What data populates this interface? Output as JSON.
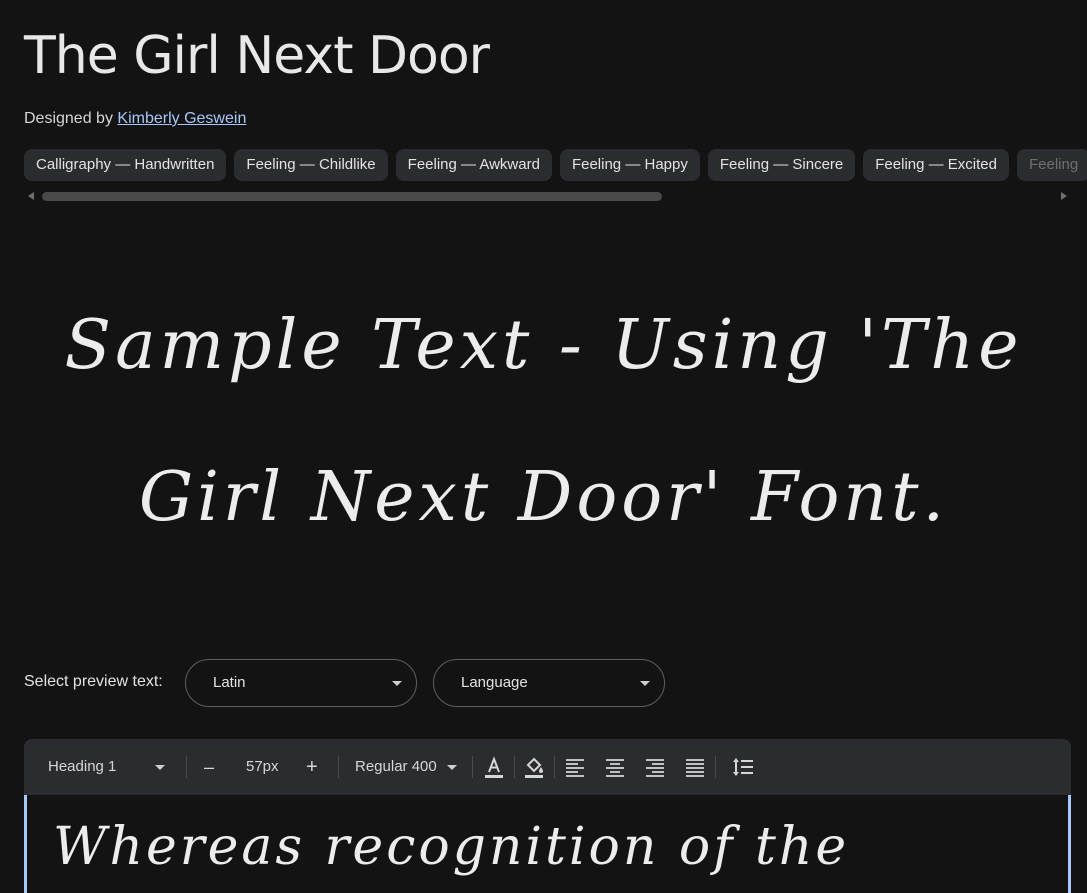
{
  "font": {
    "title": "The Girl Next Door",
    "designed_by_label": "Designed by",
    "designer": "Kimberly Geswein"
  },
  "tags": [
    "Calligraphy — Handwritten",
    "Feeling — Childlike",
    "Feeling — Awkward",
    "Feeling — Happy",
    "Feeling — Sincere",
    "Feeling — Excited",
    "Feeling"
  ],
  "sample": {
    "line1": "Sample Text - Using 'The",
    "line2": "Girl Next Door' Font."
  },
  "preview": {
    "label": "Select preview text:",
    "script_select": "Latin",
    "language_select": "Language"
  },
  "toolbar": {
    "style_select": "Heading 1",
    "decrease": "–",
    "size": "57px",
    "increase": "+",
    "weight_select": "Regular 400"
  },
  "editor": {
    "text": "Whereas recognition of the"
  },
  "icons": {
    "text_color": "text-color-icon",
    "highlight": "highlight-fill-icon",
    "align_left": "align-left-icon",
    "align_center": "align-center-icon",
    "align_right": "align-right-icon",
    "align_justify": "align-justify-icon",
    "line_height": "line-height-icon"
  },
  "colors": {
    "background": "#131313",
    "surface": "#2b2c2f",
    "link": "#a8c7fa"
  }
}
